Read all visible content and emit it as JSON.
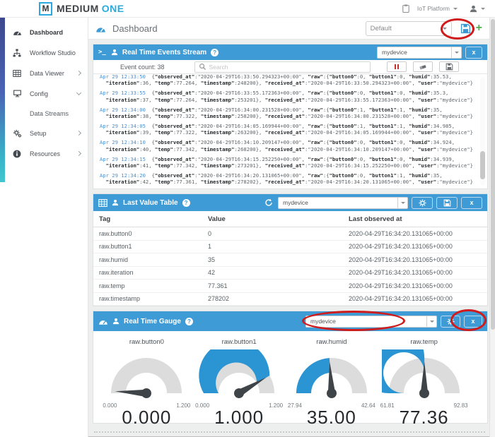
{
  "topbar": {
    "logo_m": "M",
    "brand_primary": "MEDIUM",
    "brand_accent": "ONE",
    "platform_menu": "IoT Platform"
  },
  "sidebar": {
    "items": [
      {
        "label": "Dashboard",
        "icon": "dashboard",
        "active": true
      },
      {
        "label": "Workflow Studio",
        "icon": "workflow"
      },
      {
        "label": "Data Viewer",
        "icon": "dataviewer",
        "chevron": "right"
      },
      {
        "label": "Config",
        "icon": "config",
        "chevron": "down"
      },
      {
        "label": "Data Streams",
        "sub": true
      },
      {
        "label": "Setup",
        "icon": "setup",
        "chevron": "right"
      },
      {
        "label": "Resources",
        "icon": "resources",
        "chevron": "right"
      }
    ]
  },
  "main_header": {
    "title": "Dashboard",
    "dashboard_select_value": "Default"
  },
  "events_panel": {
    "title": "Real Time Events Stream",
    "device_value": "mydevice",
    "event_count_label": "Event count: 38",
    "search_placeholder": "Search",
    "events": [
      {
        "time": "Apr 29 12:33:50",
        "l1": "{\"observed_at\":\"2020-04-29T16:33:50.294323+00:00\", \"raw\":{\"button0\":0, \"button1\":0, \"humid\":35.53,",
        "l2": "  \"iteration\":36, \"temp\":77.264, \"timestamp\":248200}, \"received_at\":\"2020-04-29T16:33:50.294323+00:00\", \"user\":\"mydevice\"}"
      },
      {
        "time": "Apr 29 12:33:55",
        "l1": "{\"observed_at\":\"2020-04-29T16:33:55.172363+00:00\", \"raw\":{\"button0\":0, \"button1\":0, \"humid\":35.3,",
        "l2": "  \"iteration\":37, \"temp\":77.264, \"timestamp\":253201}, \"received_at\":\"2020-04-29T16:33:55.172363+00:00\", \"user\":\"mydevice\"}"
      },
      {
        "time": "Apr 29 12:34:00",
        "l1": "{\"observed_at\":\"2020-04-29T16:34:00.231528+00:00\", \"raw\":{\"button0\":1, \"button1\":1, \"humid\":35,",
        "l2": "  \"iteration\":38, \"temp\":77.322, \"timestamp\":258200}, \"received_at\":\"2020-04-29T16:34:00.231528+00:00\", \"user\":\"mydevice\"}"
      },
      {
        "time": "Apr 29 12:34:05",
        "l1": "{\"observed_at\":\"2020-04-29T16:34:05.169944+00:00\", \"raw\":{\"button0\":1, \"button1\":1, \"humid\":34.985,",
        "l2": "  \"iteration\":39, \"temp\":77.322, \"timestamp\":263200}, \"received_at\":\"2020-04-29T16:34:05.169944+00:00\", \"user\":\"mydevice\"}"
      },
      {
        "time": "Apr 29 12:34:10",
        "l1": "{\"observed_at\":\"2020-04-29T16:34:10.209147+00:00\", \"raw\":{\"button0\":0, \"button1\":0, \"humid\":34.924,",
        "l2": "  \"iteration\":40, \"temp\":77.342, \"timestamp\":268200}, \"received_at\":\"2020-04-29T16:34:10.209147+00:00\", \"user\":\"mydevice\"}"
      },
      {
        "time": "Apr 29 12:34:15",
        "l1": "{\"observed_at\":\"2020-04-29T16:34:15.252250+00:00\", \"raw\":{\"button0\":0, \"button1\":0, \"humid\":34.939,",
        "l2": "  \"iteration\":41, \"temp\":77.342, \"timestamp\":273201}, \"received_at\":\"2020-04-29T16:34:15.252250+00:00\", \"user\":\"mydevice\"}"
      },
      {
        "time": "Apr 29 12:34:20",
        "l1": "{\"observed_at\":\"2020-04-29T16:34:20.131065+00:00\", \"raw\":{\"button0\":0, \"button1\":1, \"humid\":35,",
        "l2": "  \"iteration\":42, \"temp\":77.361, \"timestamp\":278202}, \"received_at\":\"2020-04-29T16:34:20.131065+00:00\", \"user\":\"mydevice\"}"
      }
    ]
  },
  "table_panel": {
    "title": "Last Value Table",
    "device_value": "mydevice",
    "columns": [
      "Tag",
      "Value",
      "Last observed at"
    ],
    "rows": [
      [
        "raw.button0",
        "0",
        "2020-04-29T16:34:20.131065+00:00"
      ],
      [
        "raw.button1",
        "1",
        "2020-04-29T16:34:20.131065+00:00"
      ],
      [
        "raw.humid",
        "35",
        "2020-04-29T16:34:20.131065+00:00"
      ],
      [
        "raw.iteration",
        "42",
        "2020-04-29T16:34:20.131065+00:00"
      ],
      [
        "raw.temp",
        "77.361",
        "2020-04-29T16:34:20.131065+00:00"
      ],
      [
        "raw.timestamp",
        "278202",
        "2020-04-29T16:34:20.131065+00:00"
      ]
    ]
  },
  "gauge_panel": {
    "title": "Real Time Gauge",
    "device_value": "mydevice",
    "gauges": [
      {
        "label": "raw.button0",
        "min": "0.000",
        "max": "1.200",
        "value": "0.000",
        "fraction": 0.02
      },
      {
        "label": "raw.button1",
        "min": "0.000",
        "max": "1.200",
        "value": "1.000",
        "fraction": 0.833
      },
      {
        "label": "raw.humid",
        "min": "27.94",
        "max": "42.64",
        "value": "35.00",
        "fraction": 0.48
      },
      {
        "label": "raw.temp",
        "min": "61.81",
        "max": "92.83",
        "value": "77.36",
        "fraction": 0.501
      }
    ]
  },
  "colors": {
    "header_blue": "#3e9bd5",
    "accent_blue": "#29abe2",
    "gauge_blue": "#2b95d3",
    "gauge_gray": "#dcdcdc",
    "needle": "#3f4449",
    "annotation_red": "#cf1b1b",
    "pause_red": "#c9302c",
    "plus_green": "#4cae4c"
  }
}
